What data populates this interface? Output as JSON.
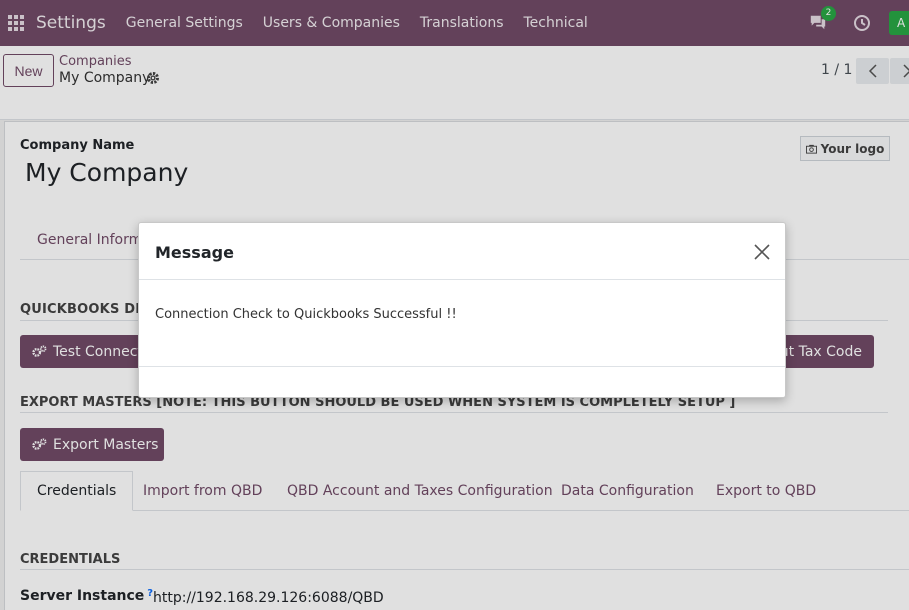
{
  "navbar": {
    "app_name": "Settings",
    "menu": [
      "General Settings",
      "Users & Companies",
      "Translations",
      "Technical"
    ],
    "chat_count": "2",
    "avatar_letter": "A",
    "color": "#714b67"
  },
  "control": {
    "new_label": "New",
    "breadcrumb_parent": "Companies",
    "breadcrumb_current": "My Company",
    "pager": "1 / 1"
  },
  "form": {
    "company_label": "Company Name",
    "company_name": "My Company",
    "logo_label": "Your logo",
    "tab_general": "General Informa",
    "qb_section": "QUICKBOOKS DESI",
    "test_button": "Test Connect",
    "tax_button": "ut Tax Code",
    "export_section": "EXPORT MASTERS [NOTE: THIS BUTTON SHOULD BE USED WHEN SYSTEM IS COMPLETELY SETUP ]",
    "export_button": "Export Masters",
    "tabs": [
      "Credentials",
      "Import from QBD",
      "QBD Account and Taxes Configuration",
      "Data Configuration",
      "Export to QBD"
    ],
    "credentials_section": "CREDENTIALS",
    "server_label": "Server Instance",
    "server_help": "?",
    "server_value": "http://192.168.29.126:6088/QBD"
  },
  "modal": {
    "title": "Message",
    "body": "Connection Check to Quickbooks Successful !!"
  }
}
